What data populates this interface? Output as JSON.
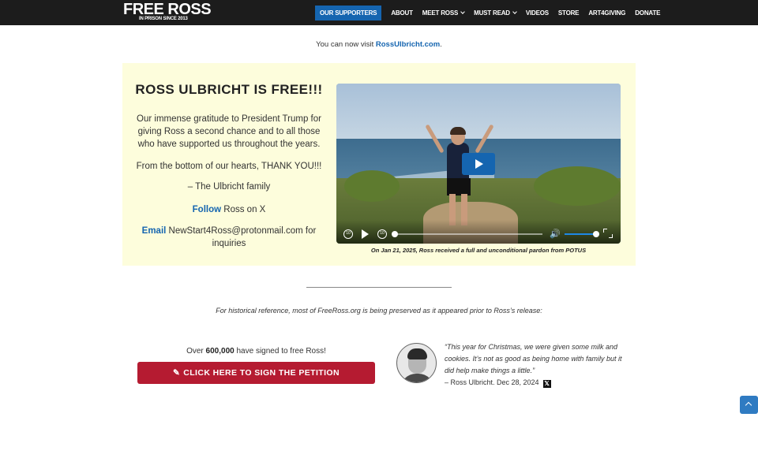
{
  "brand": {
    "logo_main": "FREE ROSS",
    "logo_sub": "IN PRISON SINCE 2013"
  },
  "nav": {
    "items": [
      {
        "label": "OUR SUPPORTERS",
        "active": true
      },
      {
        "label": "ABOUT"
      },
      {
        "label": "MEET ROSS",
        "dropdown": true
      },
      {
        "label": "MUST READ",
        "dropdown": true
      },
      {
        "label": "VIDEOS"
      },
      {
        "label": "STORE"
      },
      {
        "label": "ART4GIVING"
      },
      {
        "label": "DONATE"
      }
    ]
  },
  "notice": {
    "prefix": "You can now visit ",
    "link": "RossUlbricht.com",
    "suffix": "."
  },
  "hero": {
    "title": "ROSS ULBRICHT IS FREE!!!",
    "gratitude": "Our immense gratitude to President Trump for giving Ross a second chance and to all those who have supported us throughout the years.",
    "thanks": "From the bottom of our hearts, THANK YOU!!!",
    "signoff": "– The Ulbricht family",
    "follow_link": "Follow",
    "follow_text": " Ross on X",
    "email_link": "Email",
    "email_text": " NewStart4Ross@protonmail.com for inquiries"
  },
  "video": {
    "rewind_label": "10",
    "forward_label": "10",
    "progress": 0,
    "volume": 0.9,
    "caption": "On Jan 21, 2025, Ross received a full and unconditional pardon from POTUS"
  },
  "history_note": "For historical reference, most of FreeRoss.org is being preserved as it appeared prior to Ross’s release:",
  "petition": {
    "signed_prefix": "Over ",
    "signed_count": "600,000",
    "signed_suffix": " have signed to free Ross!",
    "button_icon": "✎",
    "button_label": "CLICK HERE TO SIGN THE PETITION"
  },
  "quote": {
    "text": "“This year for Christmas, we were given some milk and cookies. It’s not as good as being home with family but it did help make things a little.”",
    "attribution": "– Ross Ulbricht. Dec 28, 2024",
    "x_glyph": "𝕏"
  },
  "colors": {
    "accent_blue": "#1565b0",
    "petition_red": "#b51b31",
    "panel_yellow": "#fdfddc",
    "topbar": "#1c1c1c"
  }
}
